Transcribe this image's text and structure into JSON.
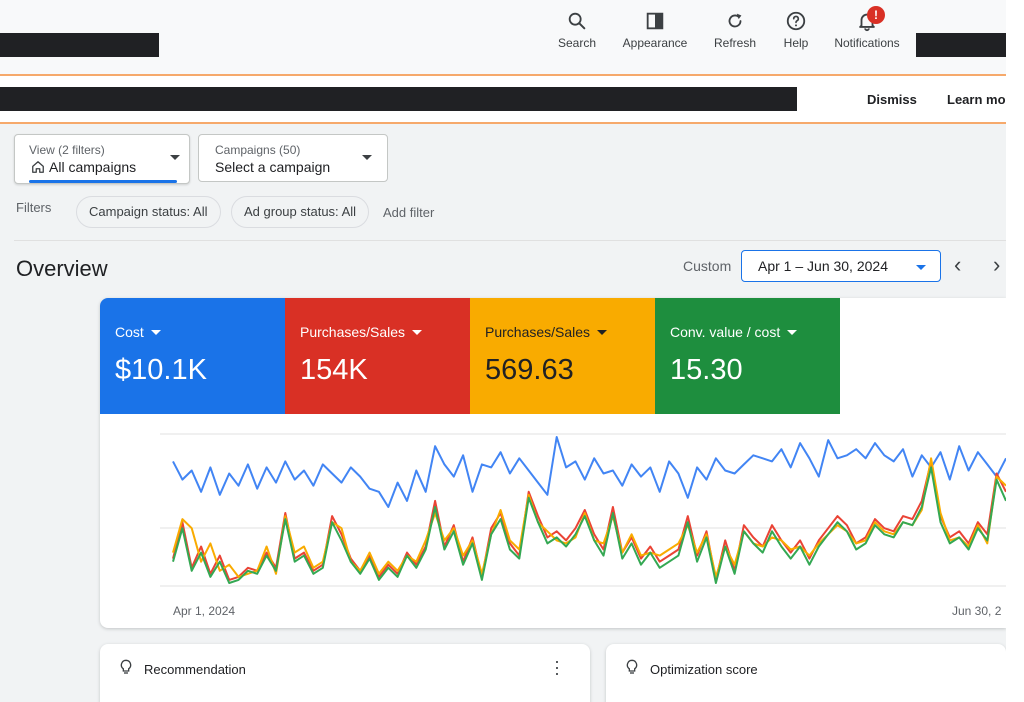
{
  "header": {
    "items": [
      {
        "label": "Search",
        "icon": "search-icon"
      },
      {
        "label": "Appearance",
        "icon": "appearance-icon"
      },
      {
        "label": "Refresh",
        "icon": "refresh-icon"
      },
      {
        "label": "Help",
        "icon": "help-icon"
      },
      {
        "label": "Notifications",
        "icon": "bell-icon",
        "badge": "!"
      }
    ]
  },
  "banner": {
    "dismiss_label": "Dismiss",
    "learn_more_label": "Learn mo"
  },
  "view_dropdown": {
    "sublabel": "View (2 filters)",
    "value": "All campaigns",
    "icon": "home-icon"
  },
  "campaign_dropdown": {
    "sublabel": "Campaigns (50)",
    "value": "Select a campaign"
  },
  "filters": {
    "label": "Filters",
    "chips": [
      "Campaign status: All",
      "Ad group status: All"
    ],
    "add_label": "Add filter"
  },
  "overview": {
    "title": "Overview",
    "custom_label": "Custom",
    "date_range": "Apr 1 – Jun 30, 2024"
  },
  "metrics": [
    {
      "label": "Cost",
      "value": "$10.1K",
      "color": "#1a73e8"
    },
    {
      "label": "Purchases/Sales",
      "value": "154K",
      "color": "#d93025"
    },
    {
      "label": "Purchases/Sales",
      "value": "569.63",
      "color": "#f9ab00"
    },
    {
      "label": "Conv. value / cost",
      "value": "15.30",
      "color": "#1e8e3e"
    }
  ],
  "chart_data": {
    "type": "line",
    "x_start_label": "Apr 1, 2024",
    "x_end_label": "Jun 30, 2",
    "series": [
      {
        "color": "#4285f4",
        "values": [
          0.82,
          0.7,
          0.76,
          0.62,
          0.78,
          0.6,
          0.74,
          0.66,
          0.8,
          0.64,
          0.78,
          0.68,
          0.82,
          0.7,
          0.76,
          0.66,
          0.8,
          0.74,
          0.68,
          0.78,
          0.72,
          0.64,
          0.62,
          0.52,
          0.68,
          0.56,
          0.76,
          0.62,
          0.92,
          0.8,
          0.72,
          0.86,
          0.62,
          0.8,
          0.78,
          0.88,
          0.74,
          0.84,
          0.76,
          0.68,
          0.6,
          0.98,
          0.78,
          0.82,
          0.7,
          0.84,
          0.74,
          0.76,
          0.66,
          0.8,
          0.72,
          0.78,
          0.62,
          0.82,
          0.74,
          0.58,
          0.78,
          0.7,
          0.84,
          0.76,
          0.74,
          0.8,
          0.86,
          0.84,
          0.82,
          0.9,
          0.78,
          0.94,
          0.84,
          0.72,
          0.96,
          0.84,
          0.86,
          0.9,
          0.84,
          0.94,
          0.86,
          0.82,
          0.9,
          0.72,
          0.86,
          0.78,
          0.88,
          0.7,
          0.92,
          0.76,
          0.88,
          0.8,
          0.72,
          0.84
        ]
      },
      {
        "color": "#ea4335",
        "values": [
          0.18,
          0.42,
          0.12,
          0.26,
          0.08,
          0.2,
          0.04,
          0.06,
          0.12,
          0.1,
          0.22,
          0.12,
          0.48,
          0.18,
          0.22,
          0.1,
          0.14,
          0.46,
          0.34,
          0.18,
          0.1,
          0.2,
          0.06,
          0.14,
          0.08,
          0.22,
          0.14,
          0.26,
          0.56,
          0.26,
          0.4,
          0.16,
          0.32,
          0.06,
          0.38,
          0.48,
          0.28,
          0.2,
          0.62,
          0.46,
          0.32,
          0.36,
          0.3,
          0.38,
          0.5,
          0.34,
          0.24,
          0.52,
          0.22,
          0.32,
          0.18,
          0.26,
          0.16,
          0.2,
          0.24,
          0.46,
          0.2,
          0.36,
          0.04,
          0.3,
          0.1,
          0.4,
          0.32,
          0.26,
          0.4,
          0.3,
          0.22,
          0.3,
          0.18,
          0.3,
          0.38,
          0.46,
          0.4,
          0.28,
          0.32,
          0.44,
          0.38,
          0.36,
          0.46,
          0.44,
          0.56,
          0.82,
          0.46,
          0.32,
          0.36,
          0.28,
          0.42,
          0.34,
          0.74,
          0.62
        ]
      },
      {
        "color": "#f9ab00",
        "values": [
          0.22,
          0.44,
          0.38,
          0.16,
          0.28,
          0.1,
          0.14,
          0.06,
          0.08,
          0.1,
          0.26,
          0.08,
          0.46,
          0.22,
          0.26,
          0.12,
          0.16,
          0.42,
          0.38,
          0.16,
          0.1,
          0.22,
          0.08,
          0.16,
          0.1,
          0.2,
          0.16,
          0.3,
          0.48,
          0.3,
          0.38,
          0.2,
          0.3,
          0.08,
          0.34,
          0.5,
          0.3,
          0.24,
          0.6,
          0.42,
          0.36,
          0.3,
          0.28,
          0.32,
          0.48,
          0.3,
          0.28,
          0.46,
          0.22,
          0.34,
          0.2,
          0.22,
          0.2,
          0.24,
          0.28,
          0.4,
          0.22,
          0.34,
          0.06,
          0.26,
          0.14,
          0.36,
          0.28,
          0.26,
          0.32,
          0.3,
          0.24,
          0.26,
          0.2,
          0.28,
          0.34,
          0.4,
          0.36,
          0.28,
          0.3,
          0.42,
          0.36,
          0.34,
          0.42,
          0.4,
          0.5,
          0.84,
          0.48,
          0.3,
          0.32,
          0.26,
          0.4,
          0.28,
          0.72,
          0.66
        ]
      },
      {
        "color": "#34a853",
        "values": [
          0.16,
          0.38,
          0.1,
          0.22,
          0.06,
          0.16,
          0.02,
          0.04,
          0.1,
          0.08,
          0.2,
          0.1,
          0.44,
          0.16,
          0.2,
          0.08,
          0.12,
          0.42,
          0.3,
          0.16,
          0.08,
          0.18,
          0.04,
          0.12,
          0.06,
          0.2,
          0.12,
          0.24,
          0.52,
          0.24,
          0.36,
          0.14,
          0.28,
          0.04,
          0.34,
          0.44,
          0.24,
          0.18,
          0.58,
          0.42,
          0.28,
          0.32,
          0.26,
          0.34,
          0.46,
          0.3,
          0.2,
          0.48,
          0.18,
          0.28,
          0.14,
          0.22,
          0.12,
          0.16,
          0.2,
          0.42,
          0.16,
          0.32,
          0.02,
          0.26,
          0.08,
          0.36,
          0.28,
          0.22,
          0.36,
          0.26,
          0.18,
          0.26,
          0.14,
          0.26,
          0.34,
          0.42,
          0.36,
          0.24,
          0.28,
          0.4,
          0.34,
          0.32,
          0.42,
          0.4,
          0.52,
          0.78,
          0.42,
          0.28,
          0.32,
          0.24,
          0.38,
          0.3,
          0.7,
          0.56
        ]
      }
    ]
  },
  "bottom_cards": [
    {
      "title": "Recommendation",
      "icon": "lightbulb-icon"
    },
    {
      "title": "Optimization score",
      "icon": "lightbulb-icon"
    }
  ]
}
